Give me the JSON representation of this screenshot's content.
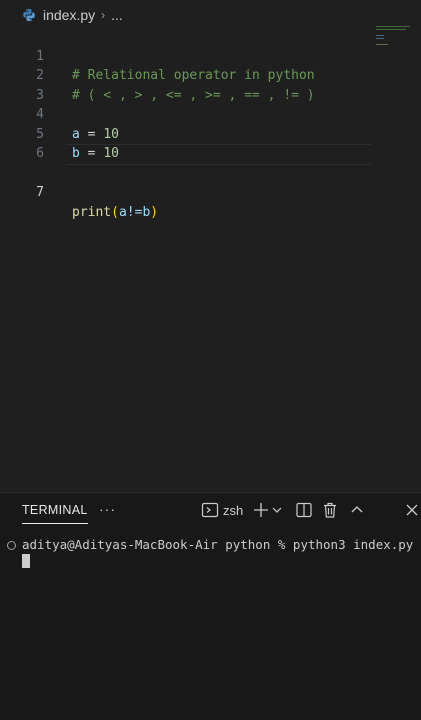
{
  "breadcrumb": {
    "file": "index.py",
    "more": "..."
  },
  "editor": {
    "lines": [
      {
        "num": "1",
        "text": "# Relational operator in python"
      },
      {
        "num": "2",
        "text": "# ( < , > , <= , >= , == , != )"
      },
      {
        "num": "3",
        "text": ""
      },
      {
        "num": "4",
        "var": "a",
        "op": " = ",
        "value": "10"
      },
      {
        "num": "5",
        "var": "b",
        "op": " = ",
        "value": "10"
      },
      {
        "num": "6",
        "text": ""
      },
      {
        "num": "7",
        "fn": "print",
        "open": "(",
        "expr": "a!=b",
        "close": ")"
      }
    ],
    "active_line": "7"
  },
  "panel": {
    "tab": "TERMINAL",
    "more": "···",
    "shell": "zsh"
  },
  "terminal": {
    "prompt": "aditya@Adityas-MacBook-Air python % python3 index.py"
  },
  "icons": {
    "file": "python-icon",
    "chevron": "chevron-right-icon",
    "terminal": "terminal-icon",
    "add": "plus-icon",
    "dropdown": "chevron-down-icon",
    "split": "split-icon",
    "trash": "trash-icon",
    "maximize": "chevron-up-icon",
    "close": "close-icon"
  },
  "colors": {
    "background": "#1f1f1f",
    "panel": "#181818",
    "comment": "#6a9955",
    "variable": "#9cdcfe",
    "number": "#b5cea8",
    "function": "#dcdcaa"
  }
}
